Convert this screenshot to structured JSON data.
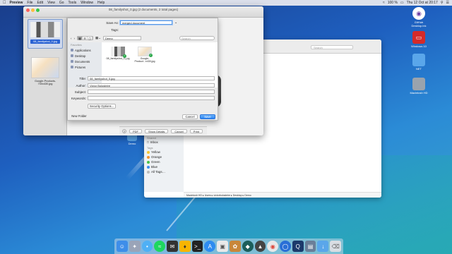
{
  "menubar": {
    "app": "Preview",
    "items": [
      "File",
      "Edit",
      "View",
      "Go",
      "Tools",
      "Window",
      "Help"
    ],
    "battery": "100 %",
    "clock": "Thu 12 Oct at 20:17"
  },
  "desktop_icons": [
    {
      "label": "GitHub Desktop.lnk",
      "icon": "github-icon"
    },
    {
      "label": "Windows 10",
      "icon": "parallels-icon"
    },
    {
      "label": "NET",
      "icon": "folder-icon"
    },
    {
      "label": "Macintosh HD",
      "icon": "hard-drive-icon"
    }
  ],
  "finder": {
    "search_placeholder": "Search",
    "sidebar_header_shared": "Shared",
    "shared_item": "Inbox",
    "tags_header": "Tags",
    "tags": [
      {
        "label": "Yellow",
        "color": "#f5c631"
      },
      {
        "label": "Orange",
        "color": "#f5932b"
      },
      {
        "label": "Green",
        "color": "#47c24a"
      },
      {
        "label": "Blue",
        "color": "#3a8cf0"
      },
      {
        "label": "All Tags…",
        "color": "#bbbbbb"
      }
    ],
    "path": [
      "Macintosh HD",
      "Users",
      "victorbolosteire",
      "Desktop",
      "Demo"
    ],
    "demo_folder_label": "Demo"
  },
  "preview": {
    "title": "08_familyshot_0.jpg (2 documents, 2 total pages)",
    "thumbs": [
      {
        "label": "08_familyshot_0.jpg",
        "selected": true
      },
      {
        "label": "Google-Products-700x430.jpg",
        "selected": false
      }
    ],
    "print_bar": {
      "pdf": "PDF",
      "show_details": "Show Details",
      "cancel": "Cancel",
      "print": "Print",
      "help": "?"
    }
  },
  "save_sheet": {
    "save_as_label": "Save As:",
    "save_as_value": "merged document",
    "tags_label": "Tags:",
    "location": "Demo",
    "search_placeholder": "Search",
    "favorites_header": "Favorites",
    "favorites": [
      {
        "label": "Applications",
        "icon": "applications-icon"
      },
      {
        "label": "Desktop",
        "icon": "desktop-icon"
      },
      {
        "label": "Documents",
        "icon": "documents-icon"
      },
      {
        "label": "Pictures",
        "icon": "pictures-icon"
      }
    ],
    "files": [
      {
        "label": "08_familyshot_0.j pg"
      },
      {
        "label": "Google-Product...x430.jpg"
      }
    ],
    "title_label": "Title:",
    "title_value": "08_familyshot_0.jpg",
    "author_label": "Author:",
    "author_value": "Victor Bolosteire",
    "subject_label": "Subject:",
    "subject_value": "",
    "keywords_label": "Keywords:",
    "keywords_value": "",
    "security_button": "Security Options...",
    "new_folder": "New Folder",
    "cancel": "Cancel",
    "save": "Save"
  },
  "dock": [
    "finder-icon",
    "launchpad-icon",
    "messages-icon",
    "spotify-icon",
    "tweetdeck-icon",
    "sketch-icon",
    "terminal-icon",
    "app-store-icon",
    "preview-icon",
    "photos-icon",
    "gitkraken-icon",
    "rocket-icon",
    "chrome-icon",
    "sourcetree-icon",
    "quicktime-icon",
    "folder-icon",
    "downloads-icon",
    "trash-icon"
  ]
}
